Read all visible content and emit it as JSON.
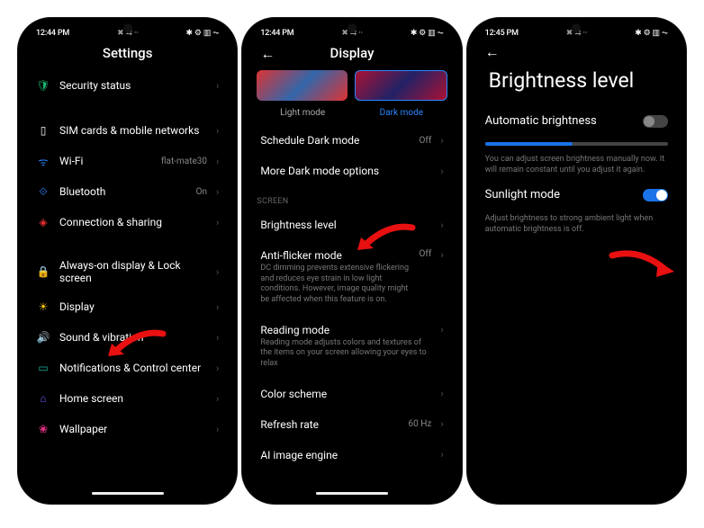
{
  "status": {
    "time1": "12:44 PM",
    "time2": "12:44 PM",
    "time3": "12:45 PM",
    "icons_left": "✖ ⇆ ··",
    "icons_right": "✱ ⚙ ▥ ⏦"
  },
  "screen1": {
    "title": "Settings",
    "items": [
      {
        "icon": "🛡",
        "color": "#19b36b",
        "label": "Security status"
      },
      {
        "spacer": true
      },
      {
        "icon": "▯",
        "color": "#fff",
        "label": "SIM cards & mobile networks"
      },
      {
        "icon": "ᯤ",
        "color": "#2b86ff",
        "label": "Wi-Fi",
        "value": "flat-mate30"
      },
      {
        "icon": "⟐",
        "color": "#2b86ff",
        "label": "Bluetooth",
        "value": "On"
      },
      {
        "icon": "◈",
        "color": "#e83030",
        "label": "Connection & sharing"
      },
      {
        "spacer": true
      },
      {
        "icon": "🔒",
        "color": "#e88a30",
        "label": "Always-on display & Lock screen"
      },
      {
        "icon": "☀",
        "color": "#f5c518",
        "label": "Display"
      },
      {
        "icon": "🔊",
        "color": "#19b36b",
        "label": "Sound & vibration"
      },
      {
        "icon": "▭",
        "color": "#19b3a0",
        "label": "Notifications & Control center"
      },
      {
        "icon": "⌂",
        "color": "#6b5bff",
        "label": "Home screen"
      },
      {
        "icon": "❀",
        "color": "#e83088",
        "label": "Wallpaper"
      }
    ]
  },
  "screen2": {
    "title": "Display",
    "light_label": "Light mode",
    "dark_label": "Dark mode",
    "top_items": [
      {
        "label": "Schedule Dark mode",
        "value": "Off"
      },
      {
        "label": "More Dark mode options"
      }
    ],
    "section": "SCREEN",
    "items": [
      {
        "label": "Brightness level"
      },
      {
        "label": "Anti-flicker mode",
        "sub": "DC dimming prevents extensive flickering and reduces eye strain in low light conditions. However, image quality might be affected when this feature is on.",
        "value": "Off"
      },
      {
        "label": "Reading mode",
        "sub": "Reading mode adjusts colors and textures of the items on your screen allowing your eyes to relax"
      },
      {
        "label": "Color scheme"
      },
      {
        "label": "Refresh rate",
        "value": "60 Hz"
      },
      {
        "label": "AI image engine"
      }
    ]
  },
  "screen3": {
    "title": "Brightness level",
    "auto_label": "Automatic brightness",
    "auto_on": false,
    "slider_pct": 48,
    "desc1": "You can adjust screen brightness manually now. It will remain constant until you adjust it again.",
    "sun_label": "Sunlight mode",
    "sun_on": true,
    "desc2": "Adjust brightness to strong ambient light when automatic brightness is off."
  }
}
